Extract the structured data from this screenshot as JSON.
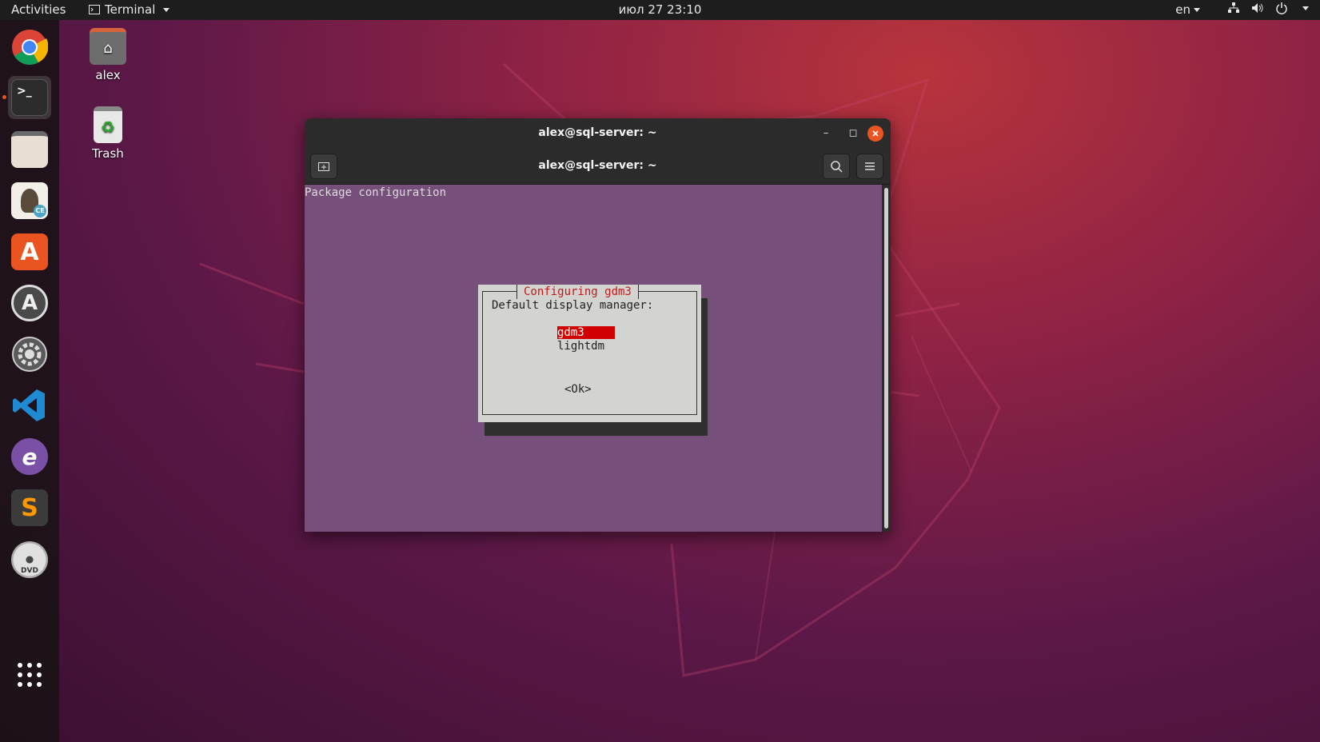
{
  "topbar": {
    "activities": "Activities",
    "app_menu": "Terminal",
    "clock": "июл 27  23:10",
    "lang": "en"
  },
  "dock": {
    "items": [
      {
        "name": "chrome-icon"
      },
      {
        "name": "terminal-icon",
        "active": true
      },
      {
        "name": "files-icon"
      },
      {
        "name": "dbeaver-icon",
        "badge": "CE"
      },
      {
        "name": "software-center-icon"
      },
      {
        "name": "software-updater-icon"
      },
      {
        "name": "settings-icon"
      },
      {
        "name": "vscode-icon"
      },
      {
        "name": "emacs-icon"
      },
      {
        "name": "sublime-text-icon"
      },
      {
        "name": "dvd-icon",
        "label": "DVD"
      },
      {
        "name": "show-applications-icon"
      }
    ]
  },
  "desktop": {
    "icons": [
      {
        "label": "alex"
      },
      {
        "label": "Trash"
      }
    ]
  },
  "terminal": {
    "window_title": "alex@sql-server: ~",
    "header_title": "alex@sql-server: ~",
    "output_line": "Package configuration",
    "dialog": {
      "title": "Configuring gdm3",
      "prompt": "Default display manager:",
      "options": [
        "gdm3",
        "lightdm"
      ],
      "selected": "gdm3",
      "ok_label": "<Ok>"
    }
  },
  "colors": {
    "accent": "#e95420",
    "terminal_bg": "#76507b",
    "dialog_bg": "#d3d3cf",
    "selection": "#d00000"
  }
}
